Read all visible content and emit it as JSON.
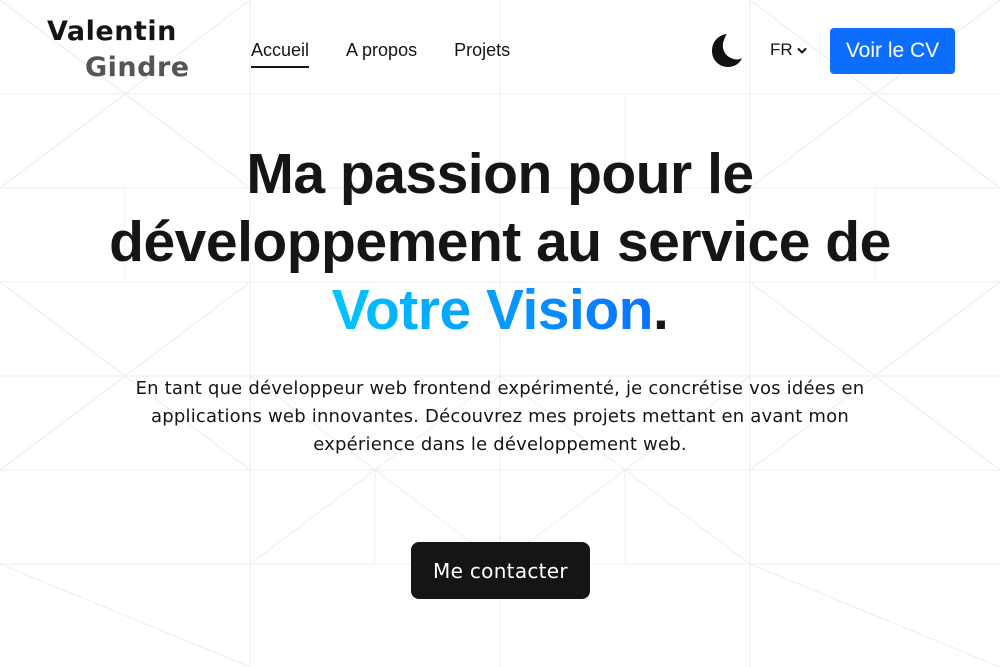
{
  "header": {
    "logo_first": "Valentin",
    "logo_last": "Gindre",
    "nav": [
      {
        "label": "Accueil",
        "active": true
      },
      {
        "label": "A propos",
        "active": false
      },
      {
        "label": "Projets",
        "active": false
      }
    ],
    "theme_icon": "moon-icon",
    "language": "FR",
    "cv_label": "Voir le CV"
  },
  "hero": {
    "title_line1": "Ma passion pour le",
    "title_line2": "développement au service de",
    "title_highlight": "Votre Vision",
    "title_end": ".",
    "description": "En tant que développeur web frontend expérimenté, je concrétise vos idées en applications web innovantes. Découvrez mes projets mettant en avant mon expérience dans le développement web.",
    "contact_label": "Me contacter"
  },
  "colors": {
    "accent": "#0d6efd",
    "dark": "#151515",
    "gradient_start": "#00c6ff",
    "gradient_end": "#0a72ff"
  }
}
